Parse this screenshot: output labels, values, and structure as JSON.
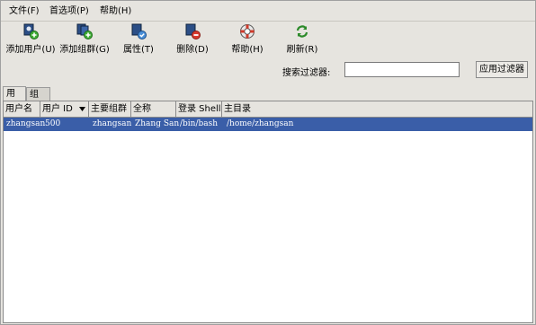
{
  "menubar": {
    "file": "文件(F)",
    "prefs": "首选项(P)",
    "help": "帮助(H)"
  },
  "toolbar": {
    "add_user": "添加用户(U)",
    "add_group": "添加组群(G)",
    "properties": "属性(T)",
    "delete": "删除(D)",
    "help": "帮助(H)",
    "refresh": "刷新(R)"
  },
  "filter": {
    "label": "搜索过滤器:",
    "value": "",
    "apply": "应用过滤器"
  },
  "tabs": [
    {
      "label": "用户",
      "active": true
    },
    {
      "label": "组群",
      "active": false
    }
  ],
  "table": {
    "columns": [
      "用户名",
      "用户 ID",
      "主要组群",
      "全称",
      "登录 Shell",
      "主目录"
    ],
    "rows": [
      {
        "username": "zhangsan",
        "uid": "500",
        "group": "zhangsan",
        "fullname": "Zhang San",
        "shell": "/bin/bash",
        "home": "/home/zhangsan",
        "selected": true
      }
    ]
  },
  "colors": {
    "selection": "#3a5ea8",
    "window_bg": "#e6e4df"
  }
}
